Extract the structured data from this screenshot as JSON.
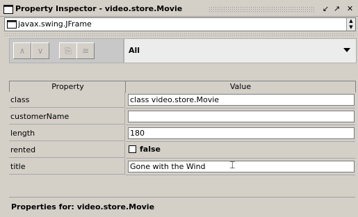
{
  "window": {
    "title": "Property Inspector - video.store.Movie",
    "buttons": [
      "restore-icon",
      "maximize-icon",
      "close-icon"
    ]
  },
  "target": {
    "value": "javax.swing.JFrame"
  },
  "toolbar": {
    "buttons": [
      "move-up-icon",
      "move-down-icon",
      "new-object-icon",
      "property-sheet-icon"
    ],
    "filter": "All"
  },
  "table": {
    "headers": [
      "Property",
      "Value"
    ],
    "rows": [
      {
        "property": "class",
        "value": "class video.store.Movie"
      },
      {
        "property": "customerName",
        "value": ""
      },
      {
        "property": "length",
        "value": "180"
      },
      {
        "property": "rented",
        "value": "false",
        "checked": false
      },
      {
        "property": "title",
        "value": "Gone with the Wind"
      }
    ]
  },
  "footer": {
    "label": "Properties for:",
    "value": "video.store.Movie"
  }
}
